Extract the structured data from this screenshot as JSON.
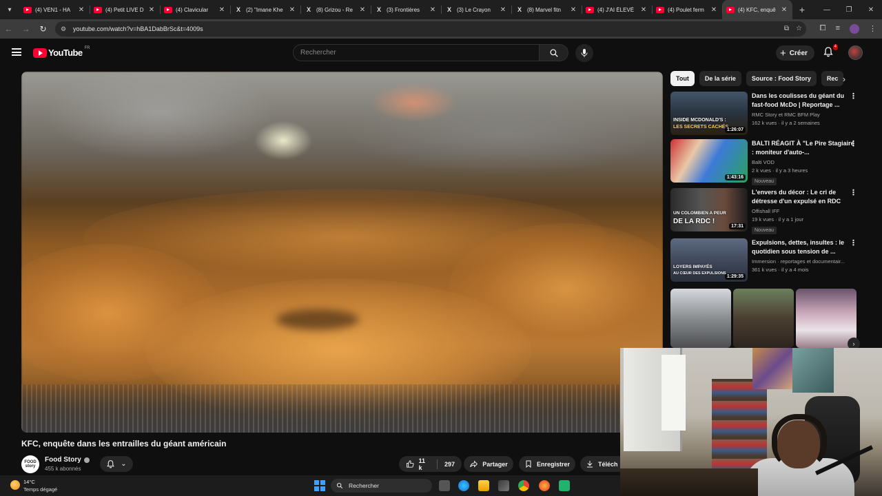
{
  "browser": {
    "tabs": [
      {
        "label": "(4) VEN1 - HA",
        "favicon": "youtube-icon"
      },
      {
        "label": "(4) Petit LIVE D",
        "favicon": "youtube-icon"
      },
      {
        "label": "(4) Clavicular",
        "favicon": "youtube-icon"
      },
      {
        "label": "(2) \"Imane Khe",
        "favicon": "x-icon"
      },
      {
        "label": "(8) Grizou - Re",
        "favicon": "x-icon"
      },
      {
        "label": "(3) Frontières",
        "favicon": "x-icon"
      },
      {
        "label": "(3) Le Crayon",
        "favicon": "x-icon"
      },
      {
        "label": "(8) Marvel fitn",
        "favicon": "x-icon"
      },
      {
        "label": "(4) J'AI ÉLEVÉ",
        "favicon": "youtube-icon"
      },
      {
        "label": "(4) Poulet ferm",
        "favicon": "youtube-icon"
      },
      {
        "label": "(4) KFC, enquê",
        "favicon": "youtube-icon",
        "active": true
      }
    ],
    "new_tab": "+",
    "url": "youtube.com/watch?v=hBA1DabBrSc&t=4009s"
  },
  "youtube": {
    "logo_text": "YouTube",
    "country_code": "FR",
    "search_placeholder": "Rechercher",
    "create_label": "Créer",
    "notification_count": "4"
  },
  "video": {
    "title": "KFC, enquête dans les entrailles du géant américain",
    "channel": "Food Story",
    "channel_avatar_text": "FOOD story",
    "subscribers": "455 k abonnés",
    "likes": "11 k",
    "comments": "297",
    "share_label": "Partager",
    "save_label": "Enregistrer",
    "download_label": "Téléch"
  },
  "chips": [
    "Tout",
    "De la série",
    "Source : Food Story",
    "Rec"
  ],
  "recommendations": [
    {
      "title": "Dans les coulisses du géant du fast-food McDo | Reportage ...",
      "channel": "RMC Story et RMC BFM Play",
      "stats": "162 k vues · il y a 2 semaines",
      "duration": "1:26:07",
      "thumb_caption_1": "INSIDE MCDONALD'S :",
      "thumb_caption_2": "LES SECRETS CACHÉS",
      "badge": ""
    },
    {
      "title": "BALTI RÉAGIT À \"Le Pire Stagiaire : moniteur d'auto-...",
      "channel": "Balti VOD",
      "stats": "2 k vues · il y a 3 heures",
      "duration": "1:43:16",
      "thumb_caption_1": "",
      "thumb_caption_2": "",
      "badge": "Nouveau"
    },
    {
      "title": "L'envers du décor : Le cri de détresse d'un expulsé en RDC",
      "channel": "Offishall IFF",
      "stats": "19 k vues · il y a 1 jour",
      "duration": "17:31",
      "thumb_caption_1": "UN COLOMBIEN A PEUR",
      "thumb_caption_2": "DE LA RDC !",
      "badge": "Nouveau"
    },
    {
      "title": "Expulsions, dettes, insultes : le quotidien sous tension de ...",
      "channel": "Immersion · reportages et documentair...",
      "stats": "361 k vues · il y a 4 mois",
      "duration": "1:29:35",
      "thumb_caption_1": "LOYERS IMPAYÉS",
      "thumb_caption_2": "AU CŒUR DES EXPULSIONS",
      "badge": ""
    }
  ],
  "taskbar": {
    "temperature": "14°C",
    "weather": "Temps dégagé",
    "search_label": "Rechercher"
  },
  "colors": {
    "youtube_red": "#ff0033",
    "background": "#0f0f0f",
    "chip_bg": "#272727",
    "windows_blue": "#3da2ff"
  }
}
